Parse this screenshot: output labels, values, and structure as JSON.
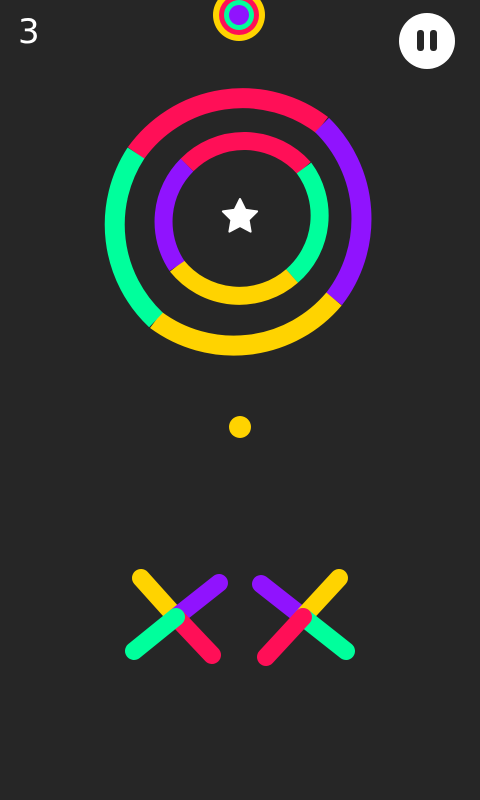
{
  "hud": {
    "score": "3",
    "pause_icon": "pause-icon"
  },
  "palette": {
    "background": "#262626",
    "red": "#ff0f57",
    "purple": "#9013fe",
    "green": "#00ff9c",
    "yellow": "#ffd300",
    "white": "#ffffff"
  },
  "player": {
    "ball_color": "yellow"
  },
  "objects": {
    "star_icon": "star-icon",
    "color_switcher_icon": "color-switcher-icon",
    "obstacles": [
      "double-ring",
      "cross-pair"
    ]
  }
}
